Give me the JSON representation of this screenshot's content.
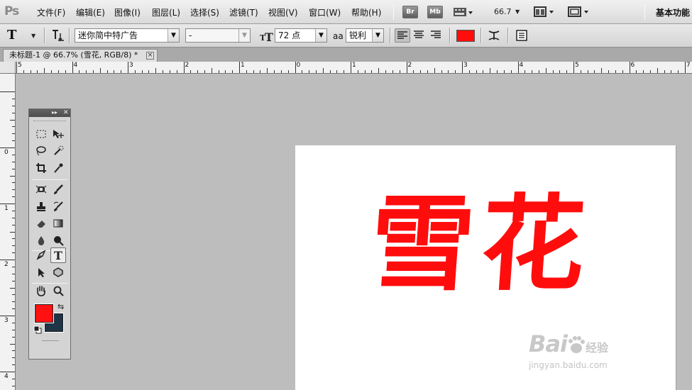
{
  "app": {
    "logo": "Ps"
  },
  "menu": {
    "items": [
      "文件(F)",
      "编辑(E)",
      "图像(I)",
      "图层(L)",
      "选择(S)",
      "滤镜(T)",
      "视图(V)",
      "窗口(W)",
      "帮助(H)"
    ],
    "bridge_label": "Br",
    "minibridge_label": "Mb",
    "zoom_value": "66.7",
    "workspace_label": "基本功能"
  },
  "options": {
    "font_family": "迷你简中特广告",
    "font_style": "-",
    "font_size": "72 点",
    "antialias_icon": "aa",
    "antialias": "锐利",
    "text_color": "#ff0d0d"
  },
  "document_tab": {
    "title": "未标题-1 @ 66.7% (雪花, RGB/8) *",
    "close_glyph": "×"
  },
  "rulers": {
    "horizontal": [
      "5",
      "4",
      "3",
      "2",
      "1",
      "0",
      "1",
      "2",
      "3",
      "4",
      "5",
      "6",
      "7"
    ],
    "vertical": [
      "0",
      "1",
      "2",
      "3",
      "4"
    ]
  },
  "canvas": {
    "text": "雪花",
    "text_color": "#ff0d0d"
  },
  "watermark": {
    "brand": "Bai",
    "brand_tail": "经验",
    "url": "jingyan.baidu.com"
  },
  "toolbox": {
    "foreground_color": "#ff1111",
    "background_color": "#1e3447",
    "tools": [
      "marquee-icon",
      "move-icon",
      "lasso-icon",
      "quick-select-icon",
      "crop-icon",
      "eyedropper-icon",
      "spot-heal-icon",
      "brush-icon",
      "clone-stamp-icon",
      "history-brush-icon",
      "eraser-icon",
      "gradient-icon",
      "blur-icon",
      "dodge-icon",
      "pen-icon",
      "type-icon",
      "path-select-icon",
      "shape-icon",
      "hand-icon",
      "zoom-icon"
    ]
  }
}
